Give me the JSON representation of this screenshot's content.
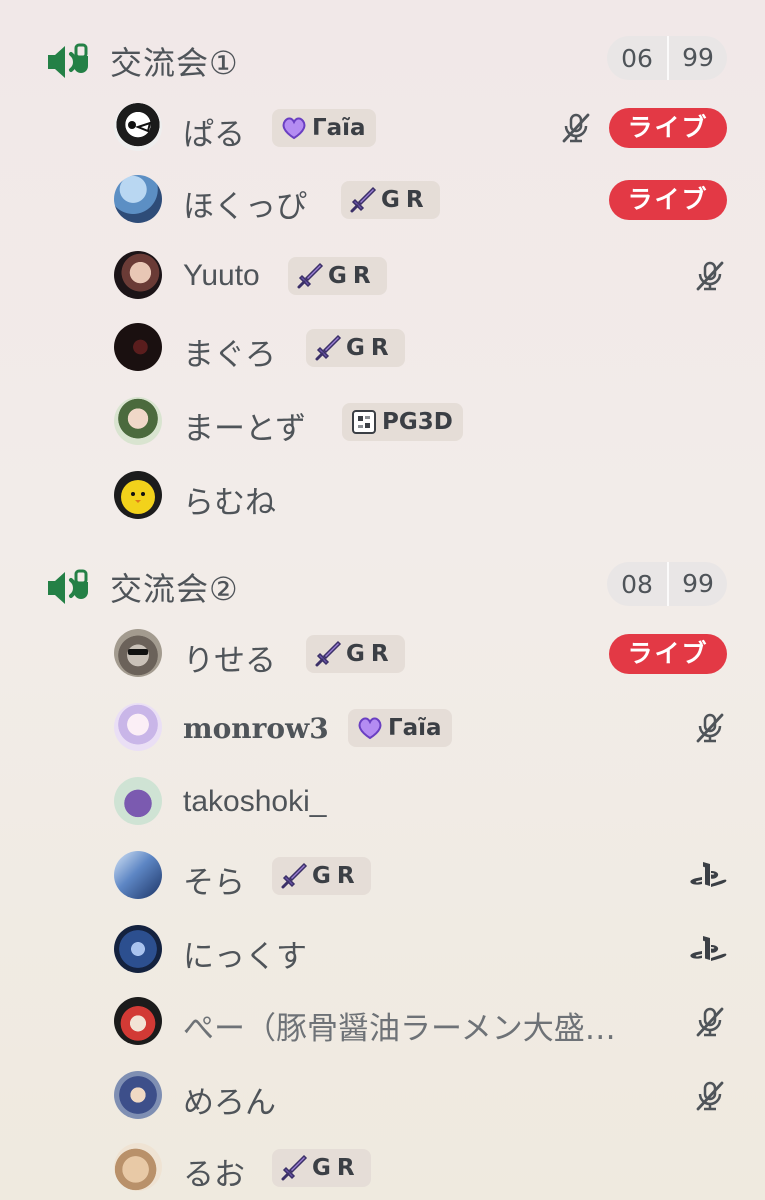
{
  "channels": [
    {
      "name": "交流会①",
      "count": "06",
      "limit": "99",
      "users": [
        {
          "name": "ぱる",
          "tag": "Γaĩa",
          "tag_icon": "purple-heart-icon",
          "status": [
            "muted-mic-icon"
          ],
          "live": "ライブ"
        },
        {
          "name": "ほくっぴ",
          "tag": "GR",
          "tag_icon": "sword-icon",
          "status": [],
          "live": "ライブ"
        },
        {
          "name": "Yuuto",
          "tag": "GR",
          "tag_icon": "sword-icon",
          "status": [
            "muted-mic-icon"
          ],
          "live": null
        },
        {
          "name": "まぐろ",
          "tag": "GR",
          "tag_icon": "sword-icon",
          "status": [],
          "live": null
        },
        {
          "name": "まーとず",
          "tag": "PG3D",
          "tag_icon": "pixel-block-icon",
          "status": [],
          "live": null
        },
        {
          "name": "らむね",
          "tag": null,
          "status": [],
          "live": null
        }
      ]
    },
    {
      "name": "交流会②",
      "count": "08",
      "limit": "99",
      "users": [
        {
          "name": "りせる",
          "tag": "GR",
          "tag_icon": "sword-icon",
          "status": [],
          "live": "ライブ"
        },
        {
          "name": "monrow3",
          "tag": "Γaĩa",
          "tag_icon": "purple-heart-icon",
          "status": [
            "muted-mic-icon"
          ],
          "live": null
        },
        {
          "name": "takoshoki_",
          "tag": null,
          "status": [],
          "live": null
        },
        {
          "name": "そら",
          "tag": "GR",
          "tag_icon": "sword-icon",
          "status": [
            "playstation-icon"
          ],
          "live": null
        },
        {
          "name": "にっくす",
          "tag": null,
          "status": [
            "playstation-icon"
          ],
          "live": null
        },
        {
          "name": "ぺー（豚骨醤油ラーメン大盛…",
          "tag": null,
          "status": [
            "muted-mic-icon"
          ],
          "live": null
        },
        {
          "name": "めろん",
          "tag": null,
          "status": [
            "muted-mic-icon"
          ],
          "live": null
        },
        {
          "name": "るお",
          "tag": "GR",
          "tag_icon": "sword-icon",
          "status": [],
          "live": null
        }
      ]
    }
  ],
  "colors": {
    "accent_green": "#248046",
    "live_red": "#e33945",
    "text": "#4f5459",
    "tag_bg": "#e5ddd7"
  }
}
